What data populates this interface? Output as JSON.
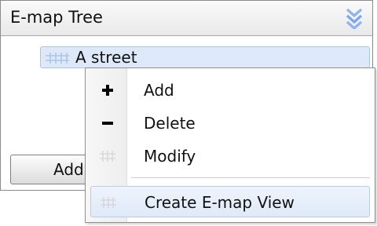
{
  "panel": {
    "title": "E-map Tree",
    "collapse_icon": "double-chevron-down-icon",
    "accent_color": "#7aa7e6"
  },
  "tree": {
    "nodes": [
      {
        "label": "A street",
        "icon": "grid-map-icon",
        "selected": true
      }
    ]
  },
  "footer": {
    "add_button_label": "Add"
  },
  "context_menu": {
    "items": [
      {
        "label": "Add",
        "icon": "plus-icon"
      },
      {
        "label": "Delete",
        "icon": "minus-icon"
      },
      {
        "label": "Modify",
        "icon": "grid-map-icon"
      },
      {
        "label": "Create E-map View",
        "icon": "grid-map-icon",
        "highlighted": true
      }
    ]
  }
}
